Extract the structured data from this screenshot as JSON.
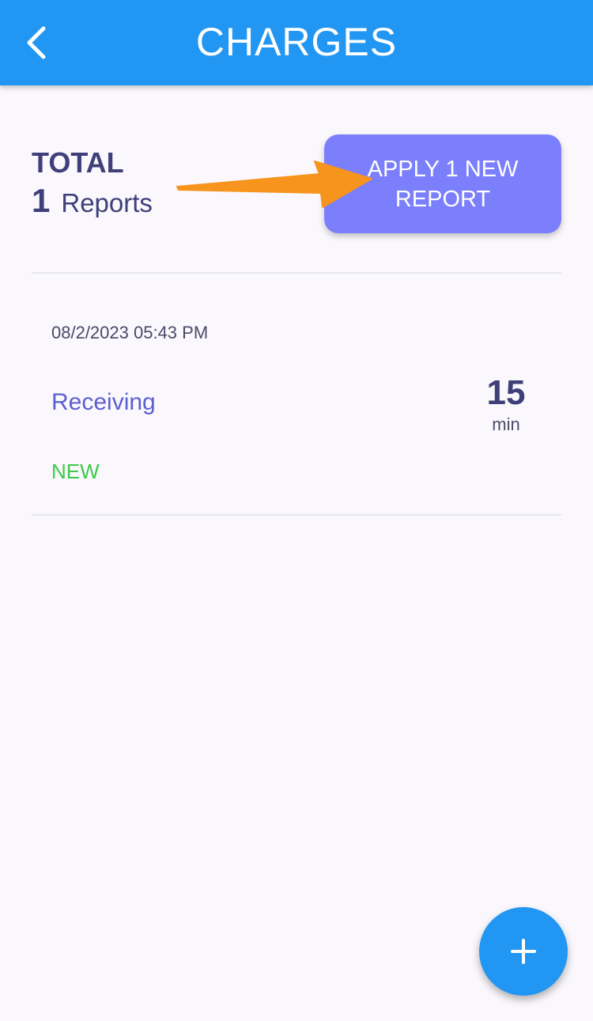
{
  "header": {
    "title": "CHARGES",
    "back_icon": "chevron-left-icon"
  },
  "summary": {
    "total_label": "TOTAL",
    "total_count": "1",
    "total_unit": "Reports"
  },
  "apply_button": {
    "line1": "APPLY 1 NEW",
    "line2": "REPORT"
  },
  "reports": [
    {
      "date": "08/2/2023 05:43 PM",
      "type": "Receiving",
      "status": "NEW",
      "duration_value": "15",
      "duration_unit": "min"
    }
  ],
  "fab": {
    "icon": "plus-icon"
  },
  "colors": {
    "header_bg": "#2196f3",
    "apply_button_bg": "#7b7ffb",
    "status_new": "#3ec94e",
    "type_text": "#5c5fd0",
    "annotation_arrow": "#f7941d"
  }
}
